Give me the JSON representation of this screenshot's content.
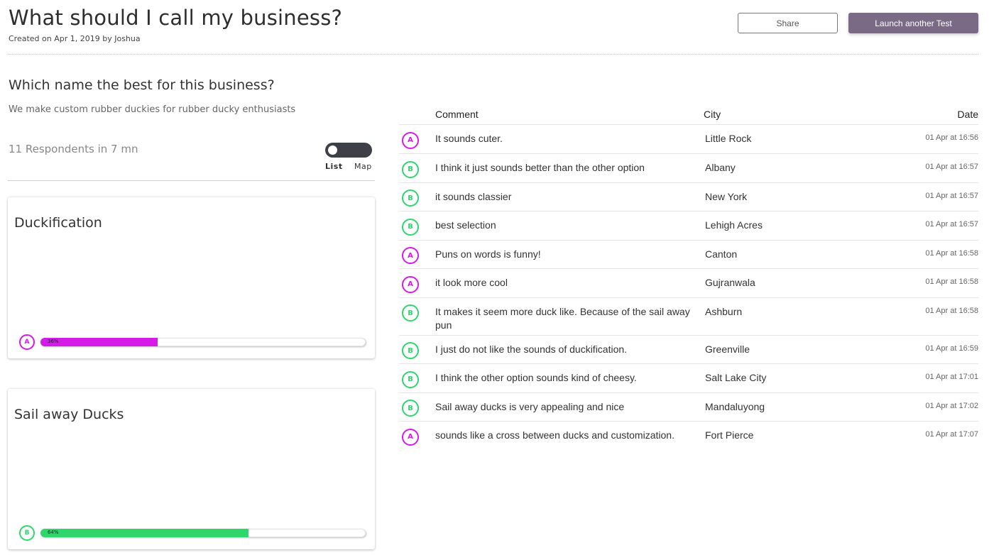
{
  "header": {
    "title": "What should I call my business?",
    "meta": "Created on Apr 1, 2019 by Joshua",
    "share_label": "Share",
    "launch_label": "Launch another Test"
  },
  "test": {
    "question": "Which name the best for this business?",
    "description": "We make custom rubber duckies for rubber ducky enthusiasts",
    "respondents": "11 Respondents in 7 mn",
    "view_toggle": {
      "list_label": "List",
      "map_label": "Map",
      "selected": "List"
    }
  },
  "options": [
    {
      "name": "Duckification",
      "letter": "A",
      "percent_label": "36%",
      "fraction": 0.36,
      "color": "#d61ae8"
    },
    {
      "name": "Sail away Ducks",
      "letter": "B",
      "percent_label": "64%",
      "fraction": 0.64,
      "color": "#2fd66b"
    }
  ],
  "colors": {
    "option_a": "#d61ae8",
    "option_b": "#2fd66b",
    "launch_button": "#7a6a86",
    "toggle_bg": "#3f3f47"
  },
  "comments": {
    "headers": {
      "comment": "Comment",
      "city": "City",
      "date": "Date"
    },
    "rows": [
      {
        "choice": "A",
        "comment": "It sounds cuter.",
        "city": "Little Rock",
        "date": "01 Apr at 16:56"
      },
      {
        "choice": "B",
        "comment": "I think it just sounds better than the other option",
        "city": "Albany",
        "date": "01 Apr at 16:57"
      },
      {
        "choice": "B",
        "comment": "it sounds classier",
        "city": "New York",
        "date": "01 Apr at 16:57"
      },
      {
        "choice": "B",
        "comment": "best selection",
        "city": "Lehigh Acres",
        "date": "01 Apr at 16:57"
      },
      {
        "choice": "A",
        "comment": "Puns on words is funny!",
        "city": "Canton",
        "date": "01 Apr at 16:58"
      },
      {
        "choice": "A",
        "comment": "it look more cool",
        "city": "Gujranwala",
        "date": "01 Apr at 16:58"
      },
      {
        "choice": "B",
        "comment": "It makes it seem more duck like.  Because of the sail away pun",
        "city": "Ashburn",
        "date": "01 Apr at 16:58"
      },
      {
        "choice": "B",
        "comment": "I just do not like the sounds of duckification.",
        "city": "Greenville",
        "date": "01 Apr at 16:59"
      },
      {
        "choice": "B",
        "comment": "I think the other option sounds kind of cheesy.",
        "city": "Salt Lake City",
        "date": "01 Apr at 17:01"
      },
      {
        "choice": "B",
        "comment": "Sail away ducks is very appealing and nice",
        "city": "Mandaluyong",
        "date": "01 Apr at 17:02"
      },
      {
        "choice": "A",
        "comment": "sounds like a cross between ducks and customization.",
        "city": "Fort Pierce",
        "date": "01 Apr at 17:07"
      }
    ]
  }
}
